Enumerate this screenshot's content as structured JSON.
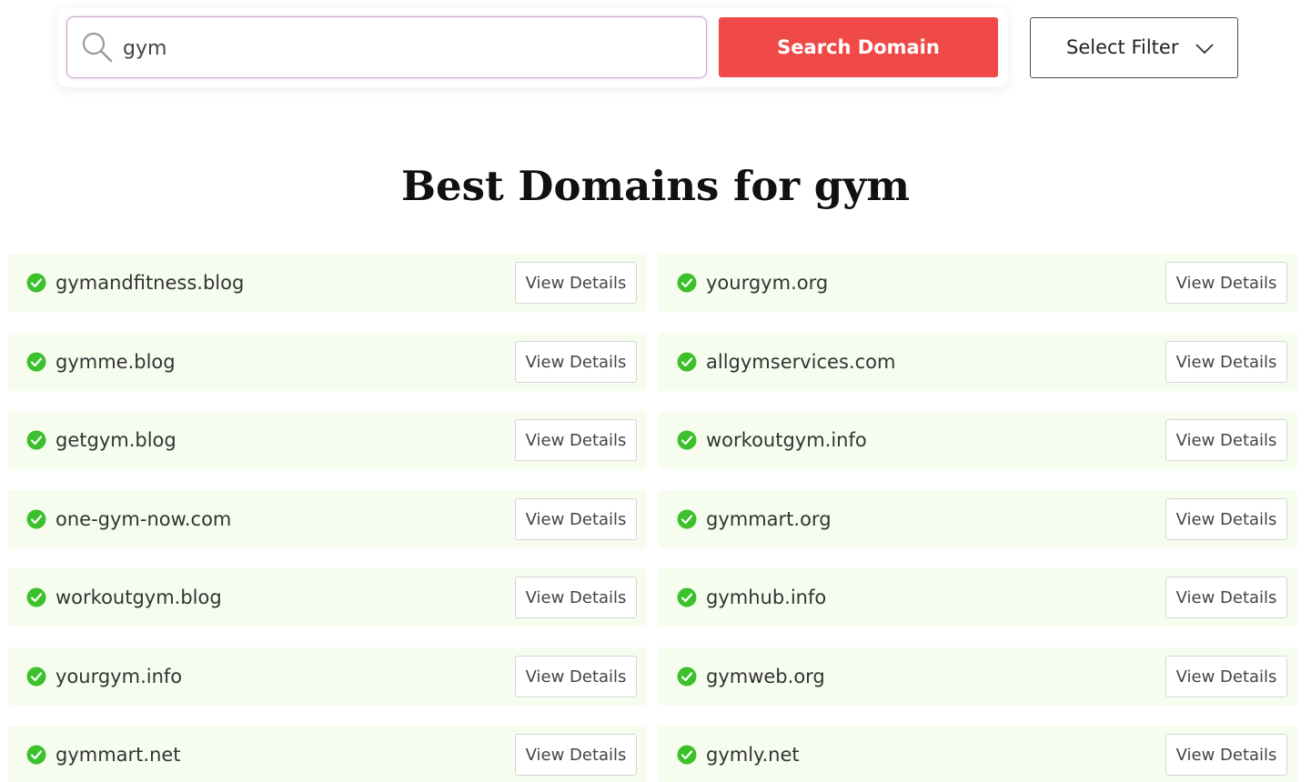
{
  "search": {
    "value": "gym",
    "button_label": "Search Domain"
  },
  "filter": {
    "label": "Select Filter"
  },
  "heading": {
    "prefix": "Best Domains for ",
    "keyword": "gym"
  },
  "colors": {
    "accent": "#f04a48",
    "card_background": "#f6fdef",
    "available": "#3cc12c"
  },
  "domains": [
    {
      "name": "gymandfitness.blog",
      "status_icon": "check-circle-icon",
      "action": "View Details"
    },
    {
      "name": "yourgym.org",
      "status_icon": "check-circle-icon",
      "action": "View Details"
    },
    {
      "name": "gymme.blog",
      "status_icon": "check-circle-icon",
      "action": "View Details"
    },
    {
      "name": "allgymservices.com",
      "status_icon": "check-circle-icon",
      "action": "View Details"
    },
    {
      "name": "getgym.blog",
      "status_icon": "check-circle-icon",
      "action": "View Details"
    },
    {
      "name": "workoutgym.info",
      "status_icon": "check-circle-icon",
      "action": "View Details"
    },
    {
      "name": "one-gym-now.com",
      "status_icon": "check-circle-icon",
      "action": "View Details"
    },
    {
      "name": "gymmart.org",
      "status_icon": "check-circle-icon",
      "action": "View Details"
    },
    {
      "name": "workoutgym.blog",
      "status_icon": "check-circle-icon",
      "action": "View Details"
    },
    {
      "name": "gymhub.info",
      "status_icon": "check-circle-icon",
      "action": "View Details"
    },
    {
      "name": "yourgym.info",
      "status_icon": "check-circle-icon",
      "action": "View Details"
    },
    {
      "name": "gymweb.org",
      "status_icon": "check-circle-icon",
      "action": "View Details"
    },
    {
      "name": "gymmart.net",
      "status_icon": "check-circle-icon",
      "action": "View Details"
    },
    {
      "name": "gymly.net",
      "status_icon": "check-circle-icon",
      "action": "View Details"
    }
  ]
}
